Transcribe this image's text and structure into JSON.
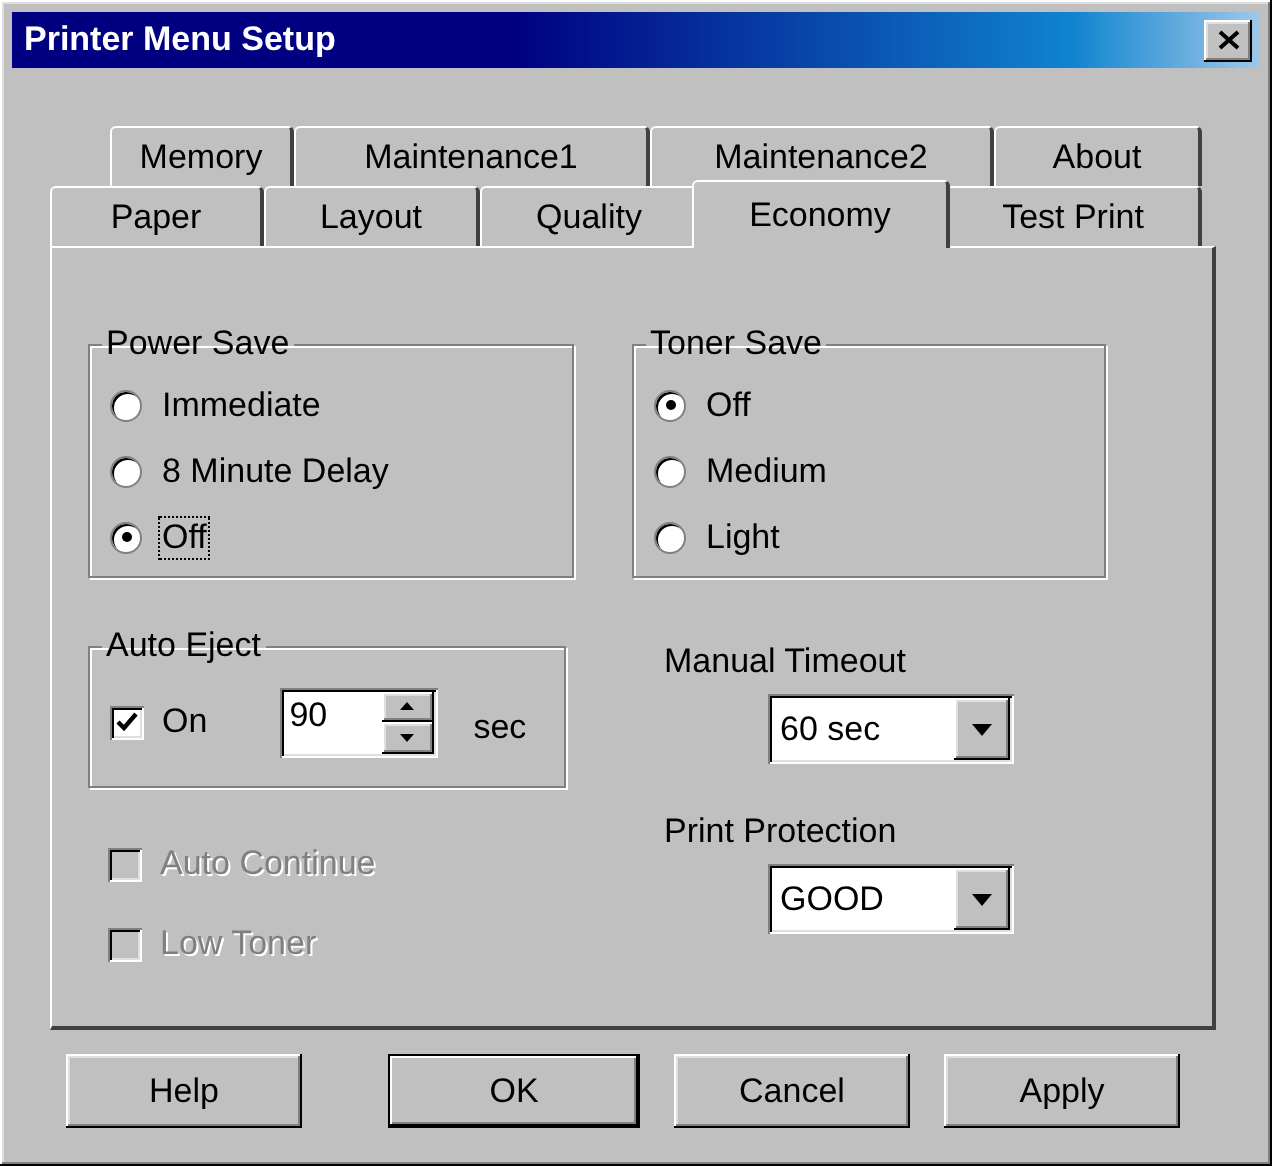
{
  "window": {
    "title": "Printer Menu Setup"
  },
  "tab_rows": [
    {
      "tabs": [
        {
          "label": "Memory",
          "selected": false
        },
        {
          "label": "Maintenance1",
          "selected": false
        },
        {
          "label": "Maintenance2",
          "selected": false
        },
        {
          "label": "About",
          "selected": false
        }
      ]
    },
    {
      "tabs": [
        {
          "label": "Paper",
          "selected": false
        },
        {
          "label": "Layout",
          "selected": false
        },
        {
          "label": "Quality",
          "selected": false
        },
        {
          "label": "Economy",
          "selected": true
        },
        {
          "label": "Test Print",
          "selected": false
        }
      ]
    }
  ],
  "power_save": {
    "label": "Power Save",
    "options": [
      {
        "label": "Immediate",
        "selected": false,
        "focused": false
      },
      {
        "label": "8 Minute Delay",
        "selected": false,
        "focused": false
      },
      {
        "label": "Off",
        "selected": true,
        "focused": true
      }
    ]
  },
  "toner_save": {
    "label": "Toner Save",
    "options": [
      {
        "label": "Off",
        "selected": true
      },
      {
        "label": "Medium",
        "selected": false
      },
      {
        "label": "Light",
        "selected": false
      }
    ]
  },
  "auto_eject": {
    "label": "Auto Eject",
    "checkbox": {
      "label": "On",
      "checked": true
    },
    "value": "90",
    "unit": "sec"
  },
  "options": [
    {
      "label": "Auto Continue",
      "checked": false,
      "disabled": true
    },
    {
      "label": "Low Toner",
      "checked": false,
      "disabled": true
    }
  ],
  "manual_timeout": {
    "label": "Manual Timeout",
    "value": "60 sec"
  },
  "print_protection": {
    "label": "Print Protection",
    "value": "GOOD"
  },
  "buttons": [
    {
      "label": "Help",
      "default": false
    },
    {
      "label": "OK",
      "default": true
    },
    {
      "label": "Cancel",
      "default": false
    },
    {
      "label": "Apply",
      "default": false
    }
  ]
}
